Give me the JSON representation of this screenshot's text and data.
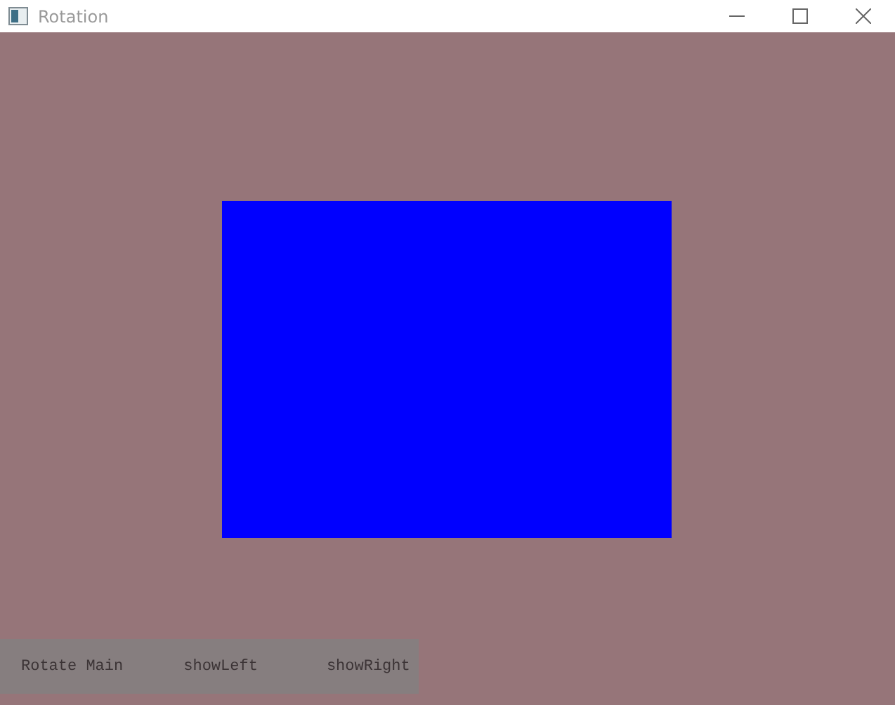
{
  "window": {
    "title": "Rotation"
  },
  "buttons": [
    {
      "label": "Rotate Main"
    },
    {
      "label": "showLeft"
    },
    {
      "label": "showRight"
    }
  ]
}
